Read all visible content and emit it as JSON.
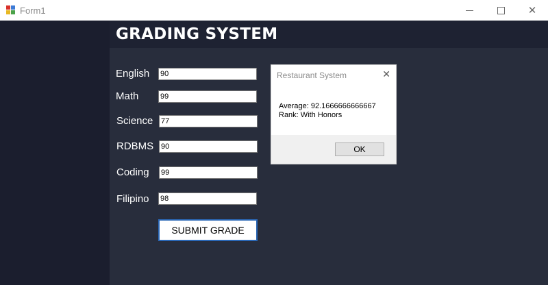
{
  "window": {
    "title": "Form1",
    "minimize_icon": "minimize-icon",
    "maximize_icon": "maximize-icon",
    "close_glyph": "✕"
  },
  "form": {
    "heading": "GRADING SYSTEM",
    "subjects": [
      {
        "label": "English",
        "value": "90"
      },
      {
        "label": "Math",
        "value": "99"
      },
      {
        "label": "Science",
        "value": "77"
      },
      {
        "label": "RDBMS",
        "value": "90"
      },
      {
        "label": "Coding",
        "value": "99"
      },
      {
        "label": "Filipino",
        "value": "98"
      }
    ],
    "submit_label": "SUBMIT GRADE"
  },
  "dialog": {
    "title": "Restaurant System",
    "close_glyph": "✕",
    "average_line": "Average: 92.1666666666667",
    "rank_line": "Rank: With Honors",
    "ok_label": "OK"
  },
  "colors": {
    "background": "#1d2131",
    "content": "#282d3c",
    "accent_border": "#2a67b6"
  }
}
